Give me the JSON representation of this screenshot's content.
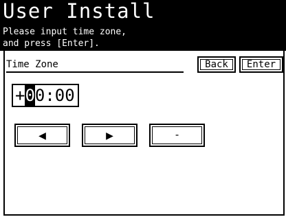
{
  "header": {
    "title": "User Install",
    "instruction_line1": "Please input time zone,",
    "instruction_line2": "and press [Enter]."
  },
  "field": {
    "label": "Time Zone"
  },
  "buttons": {
    "back": "Back",
    "enter": "Enter",
    "left_arrow": "◀",
    "right_arrow": "▶",
    "minus": "-"
  },
  "time_zone": {
    "sign": "+",
    "cursor_digit": "0",
    "rest": "0:00"
  }
}
